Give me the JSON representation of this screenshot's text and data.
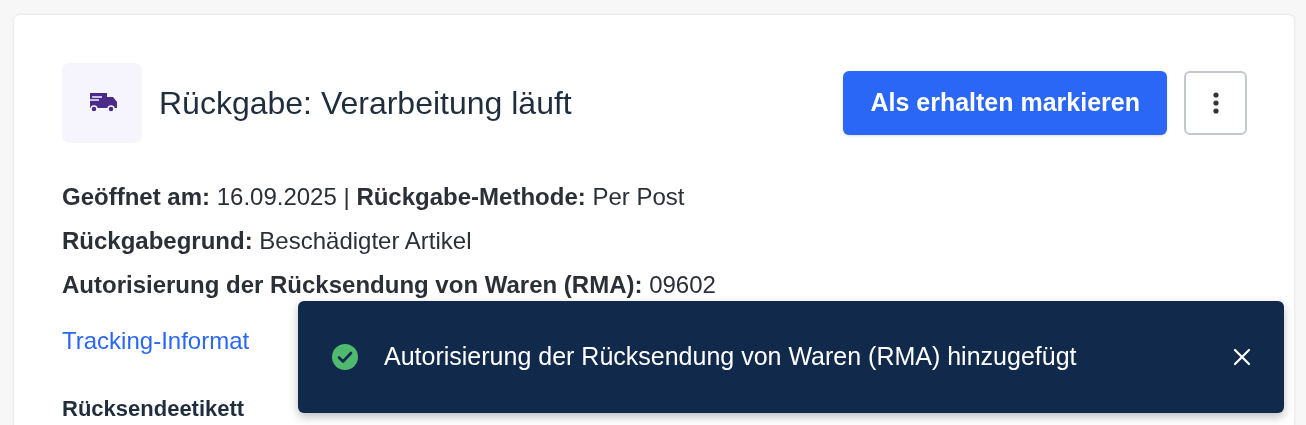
{
  "header": {
    "title": "Rückgabe: Verarbeitung läuft",
    "primary_button": "Als erhalten markieren"
  },
  "details": [
    "**Geöffnet am:** 16.09.2025 | **Rückgabe-Methode:** Per Post",
    "**Rückgabegrund:** Beschädigter Artikel",
    "**Autorisierung der Rücksendung von Waren (RMA):** 09602"
  ],
  "tracking_link": "Tracking-Informat",
  "section_heading": "Rücksendeetikett",
  "toast": {
    "kind": "success",
    "message": "Autorisierung der Rücksendung von Waren (RMA) hinzugefügt"
  }
}
